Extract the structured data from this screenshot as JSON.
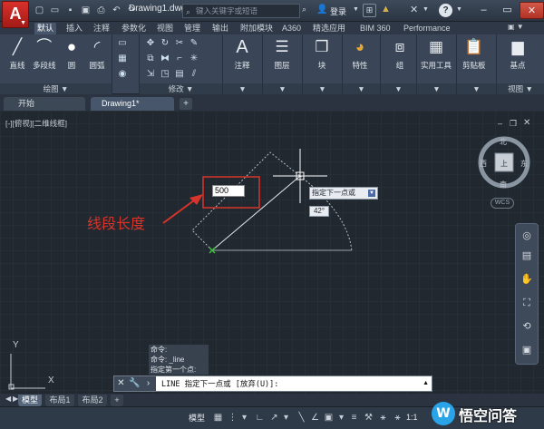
{
  "titlebar": {
    "doc_title": "Drawing1.dwg",
    "search_placeholder": "键入关键字或短语",
    "login": "登录",
    "help": "?"
  },
  "ribbon_tabs": [
    "默认",
    "插入",
    "注释",
    "参数化",
    "视图",
    "管理",
    "输出",
    "附加模块",
    "A360",
    "精选应用",
    "BIM 360",
    "Performance"
  ],
  "ribbon": {
    "draw": {
      "title": "绘图",
      "line": "直线",
      "polyline": "多段线",
      "circle": "圆",
      "arc": "圆弧"
    },
    "modify": {
      "title": "修改"
    },
    "annotation": "注释",
    "layers": "图层",
    "block": "块",
    "properties": "特性",
    "groups": "组",
    "utilities": "实用工具",
    "clipboard": "剪贴板",
    "base": "基点",
    "view": "视图"
  },
  "file_tabs": {
    "start": "开始",
    "drawing": "Drawing1*"
  },
  "canvas": {
    "viewport_label": "[-][俯视][二维线框]",
    "viewcube": {
      "north": "北",
      "south": "南",
      "east": "东",
      "west": "西",
      "top": "上"
    },
    "wcs": "WCS",
    "dynamic_input": "500",
    "prompt": "指定下一点或",
    "angle": "42°",
    "annotation": "线段长度",
    "ucs_x": "X",
    "ucs_y": "Y"
  },
  "command": {
    "history": [
      "命令:",
      "命令: _line",
      "指定第一个点:"
    ],
    "current": "LINE 指定下一点或 [放弃(U)]:"
  },
  "layout_tabs": [
    "模型",
    "布局1",
    "布局2"
  ],
  "status": {
    "model": "模型",
    "scale": "1:1"
  },
  "watermark": "悟空问答",
  "colors": {
    "accent": "#d8312b",
    "annotation": "#d7342a"
  }
}
